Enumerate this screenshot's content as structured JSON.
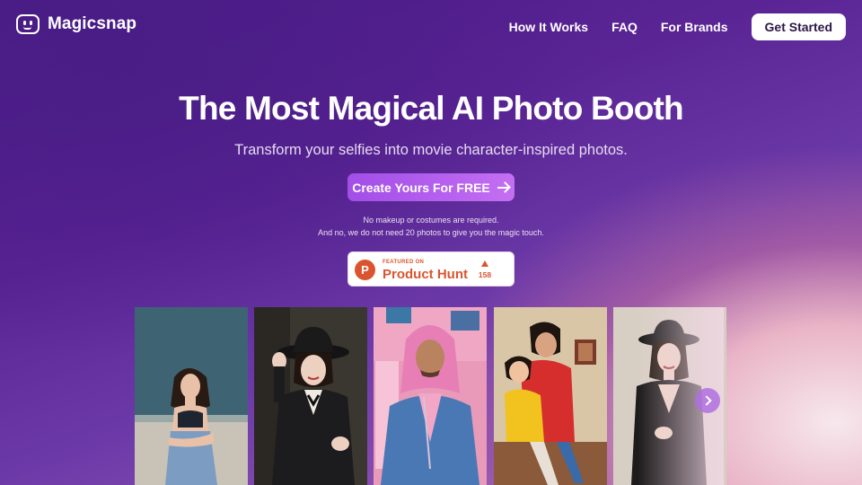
{
  "brand": {
    "name": "Magicsnap",
    "icon": "robot-face-icon"
  },
  "nav": {
    "items": [
      "How It Works",
      "FAQ",
      "For Brands"
    ],
    "cta": "Get Started"
  },
  "hero": {
    "title": "The Most Magical AI Photo Booth",
    "subtitle": "Transform your selfies into movie character-inspired photos.",
    "button": "Create Yours For FREE",
    "note_line1": "No makeup or costumes are required.",
    "note_line2": "And no, we do not need 20 photos to give you the magic touch."
  },
  "product_hunt": {
    "small": "FEATURED ON",
    "name": "Product Hunt",
    "logo_letter": "P",
    "votes": "158"
  },
  "gallery": {
    "photos": [
      "woman-jeans-photo",
      "woman-black-hat-photo",
      "man-pink-hair-photo",
      "animated-couple-photo",
      "woman-black-dress-photo"
    ],
    "next_icon": "chevron-right-icon"
  },
  "colors": {
    "accent": "#b35ef0",
    "product_hunt": "#da552f",
    "background_dark": "#4b1a86"
  }
}
